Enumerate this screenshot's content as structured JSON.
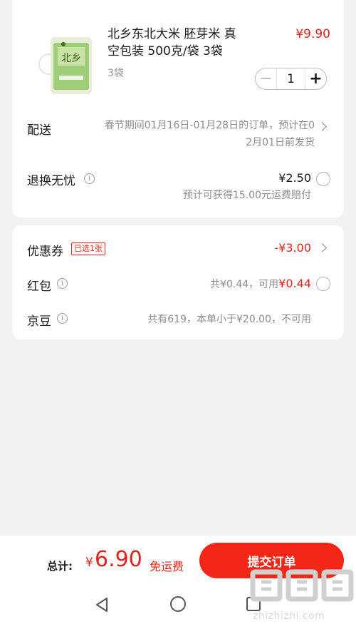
{
  "product": {
    "title_line1": "北乡东北大米 胚芽米 真",
    "title_line2": "空包装  500克/袋 3袋",
    "price": "¥9.90",
    "spec": "3袋",
    "quantity": "1",
    "minus_symbol": "−",
    "plus_symbol": "+",
    "image_icon": "rice-bag-image"
  },
  "delivery": {
    "label": "配送",
    "note_line1": "春节期间01月16日-01月28日的订单，预计在0",
    "note_line2": "2月01日前发货"
  },
  "return_service": {
    "label": "退换无忧",
    "price": "¥2.50",
    "note": "预计可获得15.00元运费赔付"
  },
  "coupon": {
    "label": "优惠券",
    "badge": "已选1张",
    "value": "-¥3.00"
  },
  "red_packet": {
    "label": "红包",
    "info_prefix": "共¥0.44，可用",
    "available": "¥0.44"
  },
  "jd_beans": {
    "label": "京豆",
    "info": "共有619，本单小于¥20.00，不可用"
  },
  "footer": {
    "total_label": "总计:",
    "currency": "¥",
    "amount": "6.90",
    "free_shipping": "免运费",
    "submit_label": "提交订单"
  },
  "watermark": {
    "site": "zhizhizhi.com"
  },
  "colors": {
    "accent": "#e2231a",
    "button": "#f22718",
    "page_bg": "#f2f2f2"
  }
}
